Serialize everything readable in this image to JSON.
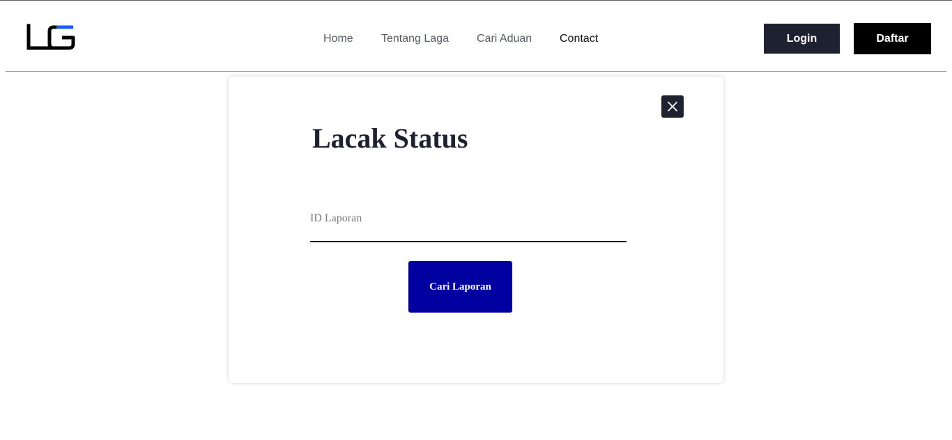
{
  "brand": {
    "logo_text": "LG",
    "logo_accent_color": "#1a5cff"
  },
  "nav": {
    "links": [
      {
        "label": "Home"
      },
      {
        "label": "Tentang Laga"
      },
      {
        "label": "Cari Aduan"
      },
      {
        "label": "Contact"
      }
    ],
    "login_label": "Login",
    "register_label": "Daftar"
  },
  "modal": {
    "title": "Lacak Status",
    "close_icon": "close-icon",
    "report_id_placeholder": "ID Laporan",
    "report_id_value": "",
    "search_button_label": "Cari Laporan"
  },
  "colors": {
    "primary_dark": "#1e2130",
    "black": "#000000",
    "button_blue": "#0000a0"
  }
}
